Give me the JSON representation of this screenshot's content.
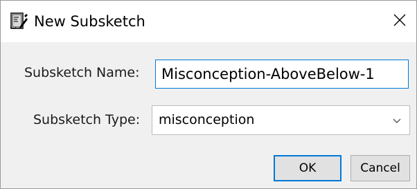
{
  "window": {
    "title": "New Subsketch"
  },
  "form": {
    "name_label": "Subsketch Name:",
    "name_value": "Misconception-AboveBelow-1",
    "type_label": "Subsketch Type:",
    "type_value": "misconception"
  },
  "buttons": {
    "ok": "OK",
    "cancel": "Cancel"
  },
  "colors": {
    "accent": "#0078d7",
    "window_bg": "#f0f0f0",
    "button_bg": "#e1e1e1"
  },
  "icons": {
    "app": "subsketch-app-icon",
    "close": "close-icon",
    "dropdown": "chevron-down-icon"
  }
}
